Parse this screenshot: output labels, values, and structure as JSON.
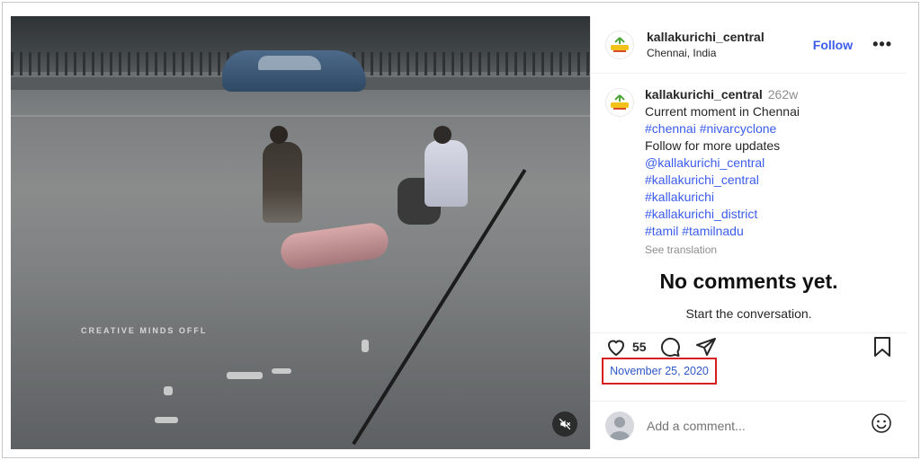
{
  "media": {
    "watermark": "CREATIVE MINDS OFFL"
  },
  "header": {
    "username": "kallakurichi_central",
    "location": "Chennai, India",
    "follow_label": "Follow",
    "more_label": "•••"
  },
  "caption": {
    "username": "kallakurichi_central",
    "age": "262w",
    "line1": "Current moment in Chennai",
    "tags1": "#chennai #nivarcyclone",
    "line2": "Follow for more updates",
    "mention": "@kallakurichi_central",
    "tag2": "#kallakurichi_central",
    "tag3": "#kallakurichi",
    "tag4": "#kallakurichi_district",
    "tag5": "#tamil  #tamilnadu",
    "see_translation": "See translation"
  },
  "comments": {
    "empty_title": "No comments yet.",
    "empty_sub": "Start the conversation."
  },
  "actions": {
    "like_count": "55",
    "icons": [
      "heart-icon",
      "comment-icon",
      "share-icon",
      "bookmark-icon"
    ]
  },
  "post": {
    "date": "November 25, 2020"
  },
  "comment_bar": {
    "placeholder": "Add a comment..."
  },
  "colors": {
    "link": "#3b5ced",
    "highlight": "#d61f1f"
  }
}
